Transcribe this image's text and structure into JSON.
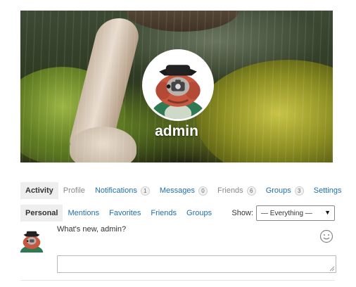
{
  "cover": {
    "user_name": "admin"
  },
  "main_nav": {
    "items": [
      {
        "label": "Activity",
        "count": null,
        "state": "current"
      },
      {
        "label": "Profile",
        "count": null,
        "state": "muted"
      },
      {
        "label": "Notifications",
        "count": "1",
        "state": "link"
      },
      {
        "label": "Messages",
        "count": "0",
        "state": "link"
      },
      {
        "label": "Friends",
        "count": "6",
        "state": "muted"
      },
      {
        "label": "Groups",
        "count": "3",
        "state": "link"
      },
      {
        "label": "Settings",
        "count": null,
        "state": "link"
      }
    ]
  },
  "sub_nav": {
    "items": [
      {
        "label": "Personal",
        "state": "current"
      },
      {
        "label": "Mentions",
        "state": "link"
      },
      {
        "label": "Favorites",
        "state": "link"
      },
      {
        "label": "Friends",
        "state": "link"
      },
      {
        "label": "Groups",
        "state": "link"
      }
    ],
    "filter_label": "Show:",
    "filter_value": "— Everything —"
  },
  "post_form": {
    "prompt": "What's new, admin?",
    "textarea_value": ""
  },
  "colors": {
    "link": "#1f6fa8",
    "current_tab_bg": "#eeeeee"
  },
  "icons": [
    "camera-icon",
    "smiley-icon",
    "caret-down-icon",
    "resize-handle-icon"
  ]
}
